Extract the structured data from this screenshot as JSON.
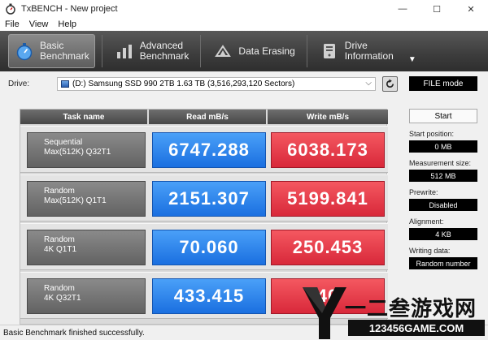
{
  "window": {
    "title": "TxBENCH - New project",
    "minimize": "—",
    "maximize": "☐",
    "close": "✕"
  },
  "menu": [
    "File",
    "View",
    "Help"
  ],
  "toolbar": {
    "buttons": [
      {
        "line1": "Basic",
        "line2": "Benchmark",
        "icon": "stopwatch-icon",
        "active": true
      },
      {
        "line1": "Advanced",
        "line2": "Benchmark",
        "icon": "bar-chart-icon",
        "active": false
      },
      {
        "line1": "Data Erasing",
        "line2": "",
        "icon": "erase-icon",
        "active": false
      },
      {
        "line1": "Drive",
        "line2": "Information",
        "icon": "drive-info-icon",
        "active": false
      }
    ],
    "more": "▼"
  },
  "drive": {
    "label": "Drive:",
    "selected": "(D:) Samsung SSD 990 2TB  1.63 TB (3,516,293,120 Sectors)",
    "mode": "FILE mode"
  },
  "table": {
    "headers": {
      "task": "Task name",
      "read": "Read mB/s",
      "write": "Write mB/s"
    },
    "rows": [
      {
        "line1": "Sequential",
        "line2": "Max(512K) Q32T1",
        "read": "6747.288",
        "write": "6038.173"
      },
      {
        "line1": "Random",
        "line2": "Max(512K) Q1T1",
        "read": "2151.307",
        "write": "5199.841"
      },
      {
        "line1": "Random",
        "line2": "4K Q1T1",
        "read": "70.060",
        "write": "250.453"
      },
      {
        "line1": "Random",
        "line2": "4K Q32T1",
        "read": "433.415",
        "write": "40"
      }
    ]
  },
  "side": {
    "start": "Start",
    "start_position_label": "Start position:",
    "start_position": "0 MB",
    "measurement_size_label": "Measurement size:",
    "measurement_size": "512 MB",
    "prewrite_label": "Prewrite:",
    "prewrite": "Disabled",
    "alignment_label": "Alignment:",
    "alignment": "4 KB",
    "writing_data_label": "Writing data:",
    "writing_data": "Random number"
  },
  "status": "Basic Benchmark finished successfully.",
  "watermark": {
    "title": "一二叁游戏网",
    "url": "123456GAME.COM"
  },
  "colors": {
    "read": "#1a6fe0",
    "write": "#d8283a",
    "toolbar": "#3c3c3c"
  }
}
